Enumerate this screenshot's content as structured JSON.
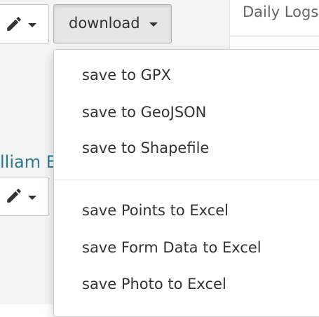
{
  "toolbar": {
    "download_label": "download"
  },
  "right_panel": {
    "title": "Daily Logs"
  },
  "row": {
    "name_text": "lliam E"
  },
  "download_menu": {
    "items": [
      "save to GPX",
      "save to GeoJSON",
      "save to Shapefile",
      "save Points to Excel",
      "save Form Data to Excel",
      "save Photo to Excel"
    ]
  },
  "icons": {
    "edit": "pencil-icon",
    "caret": "caret-down-icon"
  }
}
